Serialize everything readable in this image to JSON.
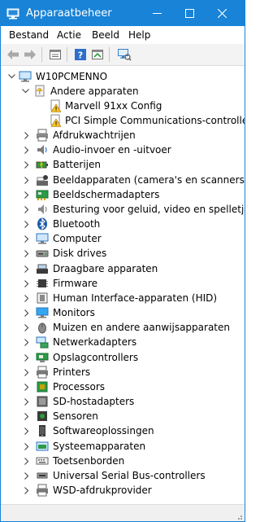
{
  "window": {
    "title": "Apparaatbeheer",
    "accent": "#1883d7"
  },
  "menu": {
    "items": [
      "Bestand",
      "Actie",
      "Beeld",
      "Help"
    ]
  },
  "toolbar": {
    "buttons": [
      "back-icon",
      "forward-icon",
      "properties-icon",
      "help-icon",
      "update-driver-icon",
      "scan-hardware-icon"
    ]
  },
  "tree": {
    "root": "W10PCMENNO",
    "other_devices": {
      "label": "Andere apparaten",
      "children": [
        "Marvell 91xx Config",
        "PCI Simple Communications-controller"
      ]
    },
    "categories": [
      "Afdrukwachtrijen",
      "Audio-invoer en -uitvoer",
      "Batterijen",
      "Beeldapparaten (camera's en scanners)",
      "Beeldschermadapters",
      "Besturing voor geluid, video en spelletjes",
      "Bluetooth",
      "Computer",
      "Disk drives",
      "Draagbare apparaten",
      "Firmware",
      "Human Interface-apparaten (HID)",
      "Monitors",
      "Muizen en andere aanwijsapparaten",
      "Netwerkadapters",
      "Opslagcontrollers",
      "Printers",
      "Processors",
      "SD-hostadapters",
      "Sensoren",
      "Softwareoplossingen",
      "Systeemapparaten",
      "Toetsenborden",
      "Universal Serial Bus-controllers",
      "WSD-afdrukprovider"
    ],
    "category_icons": [
      "printer-queue-icon",
      "speaker-icon",
      "battery-icon",
      "camera-icon",
      "display-adapter-icon",
      "sound-icon",
      "bluetooth-icon",
      "computer-icon",
      "disk-drive-icon",
      "portable-device-icon",
      "firmware-icon",
      "hid-icon",
      "monitor-icon",
      "mouse-icon",
      "network-adapter-icon",
      "storage-controller-icon",
      "printer-icon",
      "processor-icon",
      "sd-host-icon",
      "sensor-icon",
      "software-icon",
      "system-device-icon",
      "keyboard-icon",
      "usb-controller-icon",
      "wsd-printer-icon"
    ]
  }
}
